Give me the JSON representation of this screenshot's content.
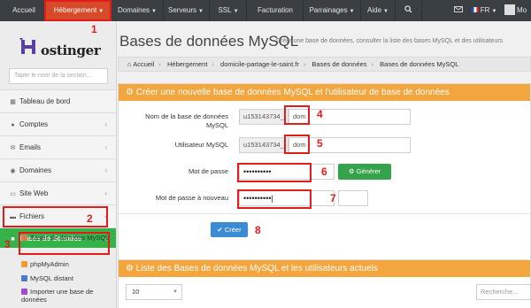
{
  "topnav": {
    "items": [
      {
        "label": "Accueil",
        "caret": false
      },
      {
        "label": "Hébergement",
        "caret": true
      },
      {
        "label": "Domaines",
        "caret": true
      },
      {
        "label": "Serveurs",
        "caret": true
      },
      {
        "label": "SSL",
        "caret": true
      },
      {
        "label": "Facturation",
        "caret": false
      },
      {
        "label": "Parrainages",
        "caret": true
      },
      {
        "label": "Aide",
        "caret": true
      }
    ],
    "language": "FR",
    "user_short": "Mo"
  },
  "sidebar": {
    "logo_text": "ostinger",
    "search_placeholder": "Taper le nom de la section...",
    "items": [
      {
        "label": "Tableau de bord",
        "icon": "dashboard-icon"
      },
      {
        "label": "Comptes",
        "icon": "user-icon"
      },
      {
        "label": "Emails",
        "icon": "mail-icon"
      },
      {
        "label": "Domaines",
        "icon": "globe-icon"
      },
      {
        "label": "Site Web",
        "icon": "monitor-icon"
      },
      {
        "label": "Fichiers",
        "icon": "folder-icon"
      },
      {
        "label": "Bases de données",
        "icon": "database-icon"
      }
    ],
    "sub_items": [
      {
        "label": "Bases de données MySQL",
        "icon": "mysql-icon"
      },
      {
        "label": "phpMyAdmin",
        "icon": "phpmyadmin-icon"
      },
      {
        "label": "MySQL distant",
        "icon": "remote-mysql-icon"
      },
      {
        "label": "Importer une base de données",
        "icon": "import-icon"
      }
    ]
  },
  "page": {
    "title": "Bases de données MySQL",
    "subtitle": "Créer une base de données, consulter la liste des bases MySQL et des utilisateurs"
  },
  "breadcrumb": [
    "Accueil",
    "Hébergement",
    "domicile-partage-le-saint.fr",
    "Bases de données",
    "Bases de données MySQL"
  ],
  "create_panel": {
    "title": "Créer une nouvelle base de données MySQL et l'utilisateur de base de données",
    "db_name_label_1": "Nom de la base de données",
    "db_name_label_2": "MySQL",
    "db_prefix": "u153143734_",
    "db_value": "dom",
    "user_label": "Utilisateur MySQL",
    "user_prefix": "u153143734_",
    "user_value": "dom",
    "password_label": "Mot de passe",
    "password_value": "••••••••••",
    "generate_label": "Générer",
    "password_confirm_label": "Mot de passe à nouveau",
    "password_confirm_value": "••••••••••|",
    "create_label": "Créer"
  },
  "list_panel": {
    "title": "Liste des Bases de données MySQL et les utilisateurs actuels",
    "page_size": "10",
    "search_placeholder": "Recherche..."
  },
  "annotations": [
    "1",
    "2",
    "3",
    "4",
    "5",
    "6",
    "7",
    "8"
  ],
  "colors": {
    "nav_bg": "#3a3f44",
    "nav_active": "#d64a2a",
    "panel_header": "#f3a53e",
    "sidebar_active": "#35b34a",
    "generate_button": "#35a34b",
    "create_button": "#3a8bd1",
    "annotation_red": "#e21b1b"
  }
}
